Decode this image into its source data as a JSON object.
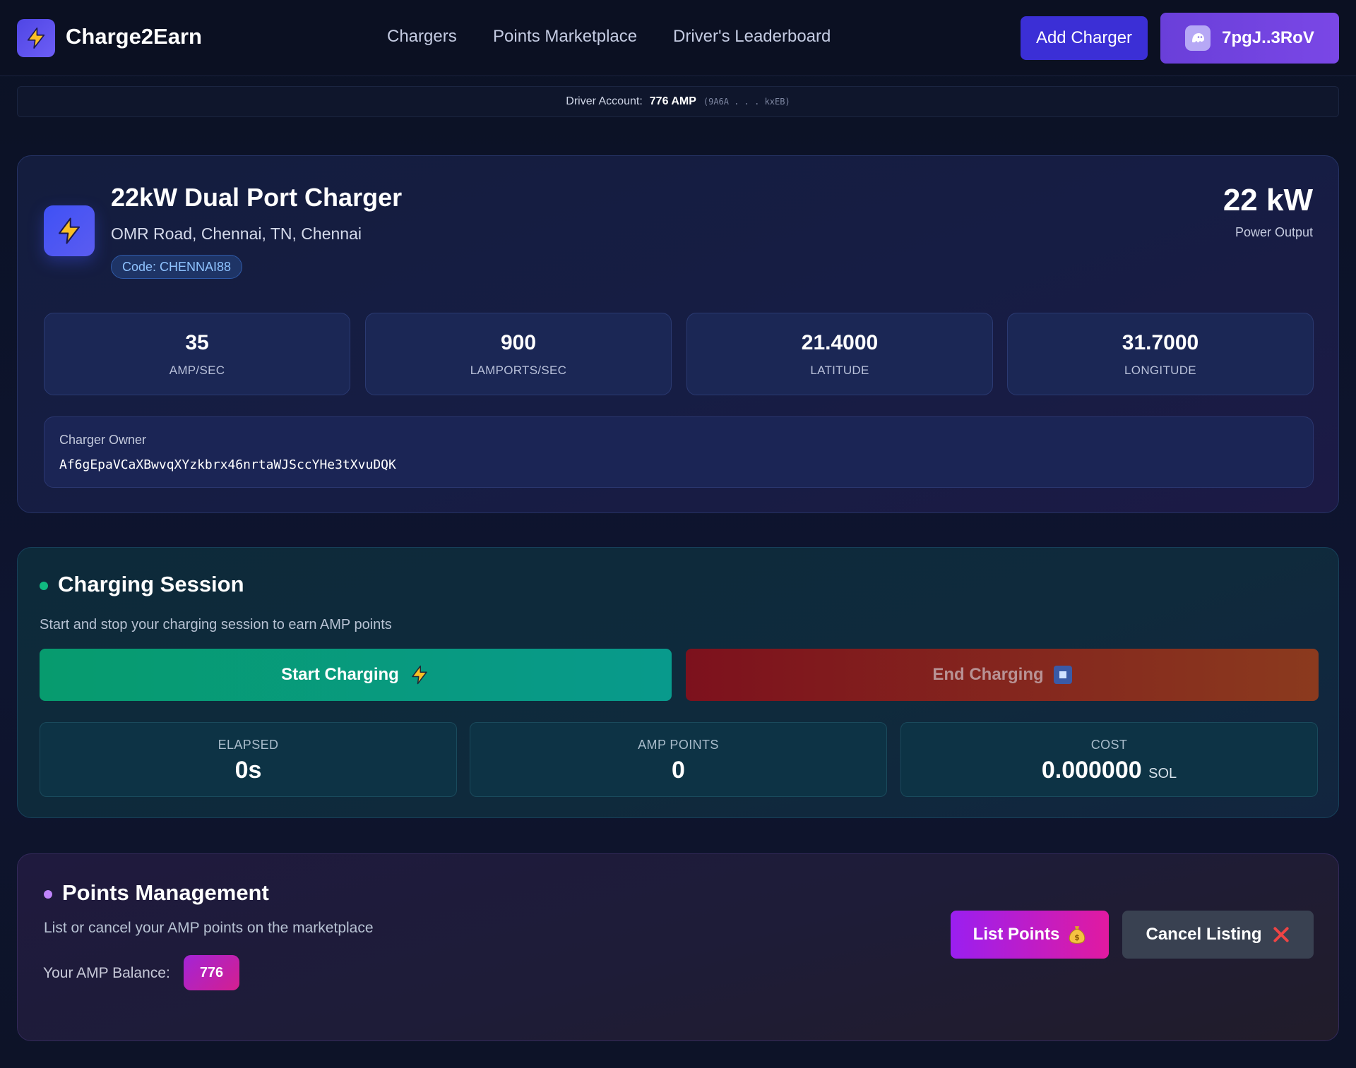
{
  "app": {
    "brand": "Charge2Earn"
  },
  "nav": {
    "links": [
      "Chargers",
      "Points Marketplace",
      "Driver's Leaderboard"
    ],
    "add_charger": "Add Charger",
    "wallet": "7pgJ..3RoV"
  },
  "account": {
    "label": "Driver Account:",
    "amount": "776 AMP",
    "address": "(9A6A . . . kxEB)"
  },
  "charger": {
    "title": "22kW Dual Port Charger",
    "address": "OMR Road, Chennai, TN, Chennai",
    "code": "Code: CHENNAI88",
    "power_value": "22 kW",
    "power_label": "Power Output",
    "stats": [
      {
        "value": "35",
        "label": "AMP/SEC"
      },
      {
        "value": "900",
        "label": "LAMPORTS/SEC"
      },
      {
        "value": "21.4000",
        "label": "LATITUDE"
      },
      {
        "value": "31.7000",
        "label": "LONGITUDE"
      }
    ],
    "owner_label": "Charger Owner",
    "owner_value": "Af6gEpaVCaXBwvqXYzkbrx46nrtaWJSccYHe3tXvuDQK"
  },
  "session": {
    "title": "Charging Session",
    "subtitle": "Start and stop your charging session to earn AMP points",
    "start_label": "Start Charging",
    "end_label": "End Charging",
    "metrics": [
      {
        "label": "ELAPSED",
        "value": "0s",
        "unit": ""
      },
      {
        "label": "AMP POINTS",
        "value": "0",
        "unit": ""
      },
      {
        "label": "COST",
        "value": "0.000000",
        "unit": "SOL"
      }
    ]
  },
  "points": {
    "title": "Points Management",
    "subtitle": "List or cancel your AMP points on the marketplace",
    "balance_label": "Your AMP Balance:",
    "balance_value": "776",
    "list_label": "List Points",
    "cancel_label": "Cancel Listing"
  },
  "colors": {
    "accent_indigo": "#3b2fd6",
    "session_dot": "#10b981",
    "points_dot": "#c084fc",
    "start_green": "#079b6e",
    "end_red": "#7d111d",
    "list_magenta": "#e11aa0"
  },
  "icons": {
    "logo": "lightning-bolt-icon",
    "wallet": "ghost-icon",
    "charger": "lightning-bolt-icon",
    "start": "lightning-bolt-icon",
    "end": "stop-icon",
    "list": "money-bag-icon",
    "cancel": "x-icon"
  }
}
